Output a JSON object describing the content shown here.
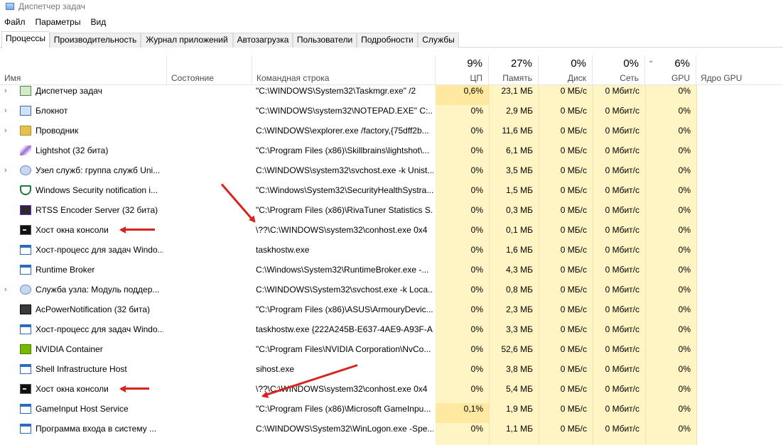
{
  "window": {
    "title": "Диспетчер задач"
  },
  "menu": [
    "Файл",
    "Параметры",
    "Вид"
  ],
  "tabs": [
    "Процессы",
    "Производительность",
    "Журнал приложений",
    "Автозагрузка",
    "Пользователи",
    "Подробности",
    "Службы"
  ],
  "columns": {
    "name": "Имя",
    "status": "Состояние",
    "command": "Командная строка",
    "cpu": {
      "pct": "9%",
      "label": "ЦП"
    },
    "memory": {
      "pct": "27%",
      "label": "Память"
    },
    "disk": {
      "pct": "0%",
      "label": "Диск"
    },
    "network": {
      "pct": "0%",
      "label": "Сеть"
    },
    "gpu": {
      "pct": "6%",
      "label": "GPU"
    },
    "gpu_engine": "Ядро GPU"
  },
  "rows": [
    {
      "icon": "task-manager-icon",
      "expandable": true,
      "name": "Диспетчер задач",
      "command": "\"C:\\WINDOWS\\System32\\Taskmgr.exe\" /2",
      "cpu": "0,6%",
      "memory": "23,1 МБ",
      "disk": "0 МБ/с",
      "network": "0 Мбит/с",
      "gpu": "0%"
    },
    {
      "icon": "notepad-icon",
      "expandable": true,
      "name": "Блокнот",
      "command": "\"C:\\WINDOWS\\system32\\NOTEPAD.EXE\" C:...",
      "cpu": "0%",
      "memory": "2,9 МБ",
      "disk": "0 МБ/с",
      "network": "0 Мбит/с",
      "gpu": "0%"
    },
    {
      "icon": "folder-icon",
      "expandable": true,
      "name": "Проводник",
      "command": "C:\\WINDOWS\\explorer.exe /factory,{75dff2b...",
      "cpu": "0%",
      "memory": "11,6 МБ",
      "disk": "0 МБ/с",
      "network": "0 Мбит/с",
      "gpu": "0%"
    },
    {
      "icon": "feather-icon",
      "expandable": false,
      "name": "Lightshot (32 бита)",
      "command": "\"C:\\Program Files (x86)\\Skillbrains\\lightshot\\...",
      "cpu": "0%",
      "memory": "6,1 МБ",
      "disk": "0 МБ/с",
      "network": "0 Мбит/с",
      "gpu": "0%"
    },
    {
      "icon": "gear-icon",
      "expandable": true,
      "name": "Узел служб: группа служб Uni...",
      "command": "C:\\WINDOWS\\system32\\svchost.exe -k Unist...",
      "cpu": "0%",
      "memory": "3,5 МБ",
      "disk": "0 МБ/с",
      "network": "0 Мбит/с",
      "gpu": "0%"
    },
    {
      "icon": "shield-icon",
      "expandable": false,
      "name": "Windows Security notification i...",
      "command": "\"C:\\Windows\\System32\\SecurityHealthSystra...",
      "cpu": "0%",
      "memory": "1,5 МБ",
      "disk": "0 МБ/с",
      "network": "0 Мбит/с",
      "gpu": "0%"
    },
    {
      "icon": "rtss-icon",
      "expandable": false,
      "name": "RTSS Encoder Server (32 бита)",
      "command": "\"C:\\Program Files (x86)\\RivaTuner Statistics S...",
      "cpu": "0%",
      "memory": "0,3 МБ",
      "disk": "0 МБ/с",
      "network": "0 Мбит/с",
      "gpu": "0%"
    },
    {
      "icon": "console-icon",
      "expandable": false,
      "name": "Хост окна консоли",
      "command": "\\??\\C:\\WINDOWS\\system32\\conhost.exe 0x4",
      "cpu": "0%",
      "memory": "0,1 МБ",
      "disk": "0 МБ/с",
      "network": "0 Мбит/с",
      "gpu": "0%"
    },
    {
      "icon": "window-icon",
      "expandable": false,
      "name": "Хост-процесс для задач Windo...",
      "command": "taskhostw.exe",
      "cpu": "0%",
      "memory": "1,6 МБ",
      "disk": "0 МБ/с",
      "network": "0 Мбит/с",
      "gpu": "0%"
    },
    {
      "icon": "window-icon",
      "expandable": false,
      "name": "Runtime Broker",
      "command": "C:\\Windows\\System32\\RuntimeBroker.exe -...",
      "cpu": "0%",
      "memory": "4,3 МБ",
      "disk": "0 МБ/с",
      "network": "0 Мбит/с",
      "gpu": "0%"
    },
    {
      "icon": "gear-icon",
      "expandable": true,
      "name": "Служба узла: Модуль поддер...",
      "command": "C:\\WINDOWS\\System32\\svchost.exe -k Loca...",
      "cpu": "0%",
      "memory": "0,8 МБ",
      "disk": "0 МБ/с",
      "network": "0 Мбит/с",
      "gpu": "0%"
    },
    {
      "icon": "chip-icon",
      "expandable": false,
      "name": "AcPowerNotification (32 бита)",
      "command": "\"C:\\Program Files (x86)\\ASUS\\ArmouryDevic...",
      "cpu": "0%",
      "memory": "2,3 МБ",
      "disk": "0 МБ/с",
      "network": "0 Мбит/с",
      "gpu": "0%"
    },
    {
      "icon": "window-icon",
      "expandable": false,
      "name": "Хост-процесс для задач Windo...",
      "command": "taskhostw.exe {222A245B-E637-4AE9-A93F-A...",
      "cpu": "0%",
      "memory": "3,3 МБ",
      "disk": "0 МБ/с",
      "network": "0 Мбит/с",
      "gpu": "0%"
    },
    {
      "icon": "nvidia-icon",
      "expandable": false,
      "name": "NVIDIA Container",
      "command": "\"C:\\Program Files\\NVIDIA Corporation\\NvCo...",
      "cpu": "0%",
      "memory": "52,6 МБ",
      "disk": "0 МБ/с",
      "network": "0 Мбит/с",
      "gpu": "0%"
    },
    {
      "icon": "window-icon",
      "expandable": false,
      "name": "Shell Infrastructure Host",
      "command": "sihost.exe",
      "cpu": "0%",
      "memory": "3,8 МБ",
      "disk": "0 МБ/с",
      "network": "0 Мбит/с",
      "gpu": "0%"
    },
    {
      "icon": "console-icon",
      "expandable": false,
      "name": "Хост окна консоли",
      "command": "\\??\\C:\\WINDOWS\\system32\\conhost.exe 0x4",
      "cpu": "0%",
      "memory": "5,4 МБ",
      "disk": "0 МБ/с",
      "network": "0 Мбит/с",
      "gpu": "0%"
    },
    {
      "icon": "window-icon",
      "expandable": false,
      "name": "GameInput Host Service",
      "command": "\"C:\\Program Files (x86)\\Microsoft GameInpu...",
      "cpu": "0,1%",
      "memory": "1,9 МБ",
      "disk": "0 МБ/с",
      "network": "0 Мбит/с",
      "gpu": "0%"
    },
    {
      "icon": "window-icon",
      "expandable": false,
      "name": "Программа входа в систему ...",
      "command": "C:\\WINDOWS\\System32\\WinLogon.exe -Spe...",
      "cpu": "0%",
      "memory": "1,1 МБ",
      "disk": "0 МБ/с",
      "network": "0 Мбит/с",
      "gpu": "0%"
    }
  ],
  "annotation_color": "#d8231f"
}
